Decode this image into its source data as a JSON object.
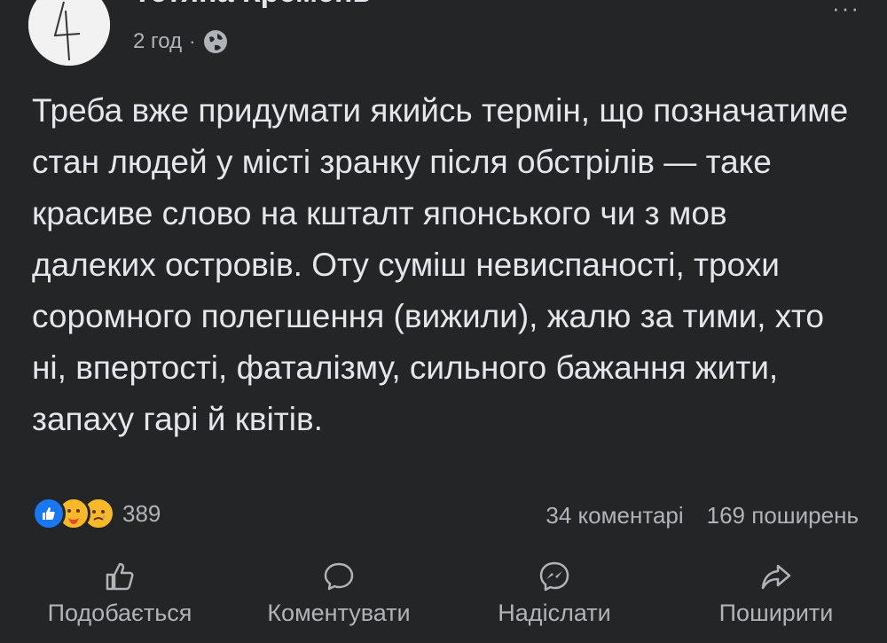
{
  "header": {
    "author_name": "Тетяна Кремень",
    "time": "2 год",
    "separator": "·",
    "privacy_icon": "globe-icon",
    "more_icon": "more-options-icon",
    "more_glyph": "···"
  },
  "post": {
    "text": "Треба вже придумати якийсь термін, що позначатиме стан людей у місті зранку після обстрілів — таке красиве слово на кшталт японського чи з мов далеких островів. Оту суміш невиспаності, трохи соромного полегшення (вижили), жалю за тими, хто ні, впертості, фаталізму, сильного бажання жити, запаху гарі й квітів."
  },
  "reactions": {
    "icons": [
      "like-reaction-icon",
      "care-reaction-icon",
      "sad-reaction-icon"
    ],
    "count": "389"
  },
  "stats": {
    "comments": "34 коментарі",
    "shares": "169 поширень"
  },
  "actions": {
    "like": "Подобається",
    "comment": "Коментувати",
    "send": "Надіслати",
    "share": "Поширити"
  },
  "colors": {
    "background": "#242526",
    "text_primary": "#e4e6eb",
    "text_secondary": "#b0b3b8",
    "like_blue": "#1877f2",
    "reaction_yellow": "#f7b928"
  }
}
